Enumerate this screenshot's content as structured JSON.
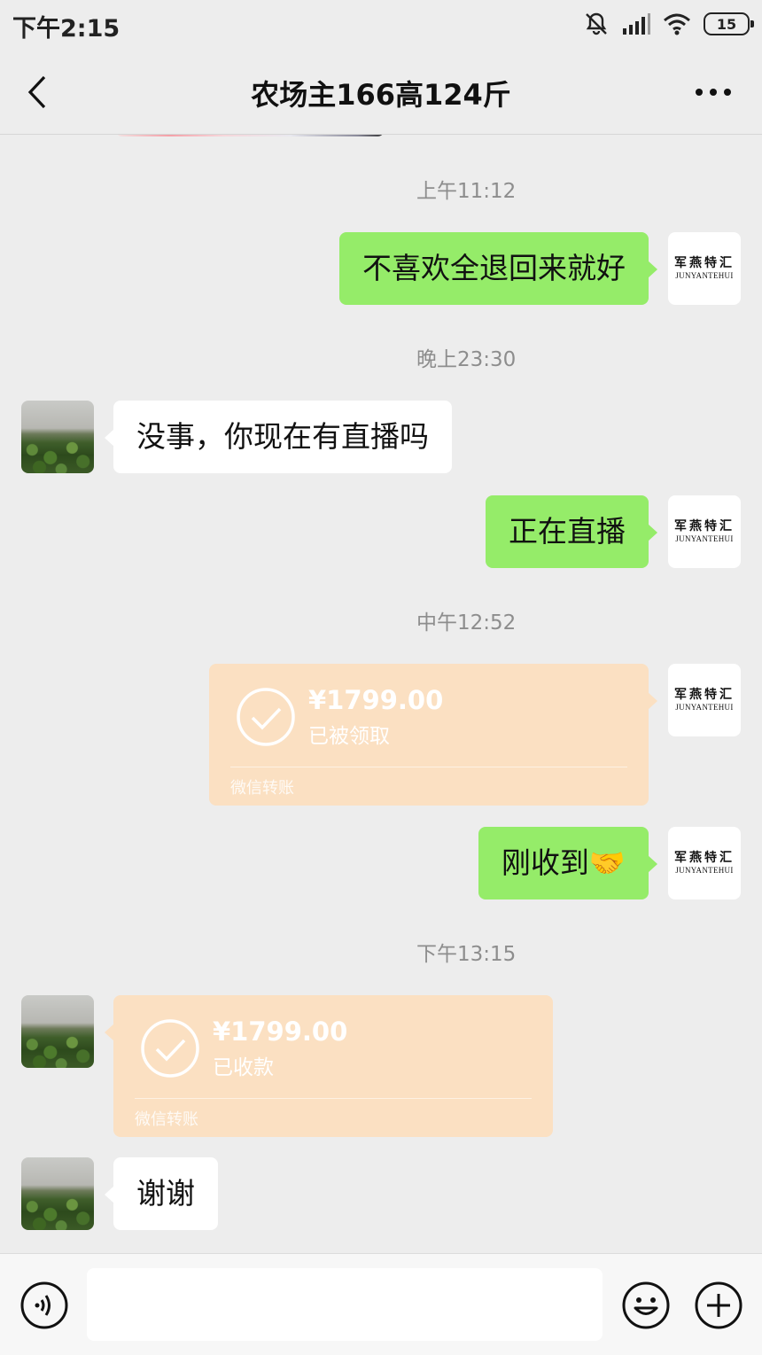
{
  "status_bar": {
    "time": "下午2:15",
    "battery": "15"
  },
  "nav": {
    "title": "农场主166高124斤"
  },
  "my_avatar": {
    "cn": "军燕特汇",
    "en": "JUNYANTEHUI"
  },
  "messages": [
    {
      "type": "time",
      "text": "上午11:12"
    },
    {
      "type": "text",
      "from": "me",
      "text": "不喜欢全退回来就好"
    },
    {
      "type": "time",
      "text": "晚上23:30"
    },
    {
      "type": "text",
      "from": "other",
      "text": "没事，你现在有直播吗"
    },
    {
      "type": "text",
      "from": "me",
      "text": "正在直播"
    },
    {
      "type": "time",
      "text": "中午12:52"
    },
    {
      "type": "transfer",
      "from": "me",
      "amount": "¥1799.00",
      "status": "已被领取",
      "footer": "微信转账"
    },
    {
      "type": "text",
      "from": "me",
      "text": "刚收到🤝"
    },
    {
      "type": "time",
      "text": "下午13:15"
    },
    {
      "type": "transfer",
      "from": "other",
      "amount": "¥1799.00",
      "status": "已收款",
      "footer": "微信转账"
    },
    {
      "type": "text",
      "from": "other",
      "text": "谢谢"
    }
  ],
  "input": {
    "value": "",
    "placeholder": ""
  },
  "colors": {
    "my_bubble": "#95ec69",
    "other_bubble": "#ffffff",
    "transfer_card": "#fbe0c2",
    "background": "#ededed"
  }
}
